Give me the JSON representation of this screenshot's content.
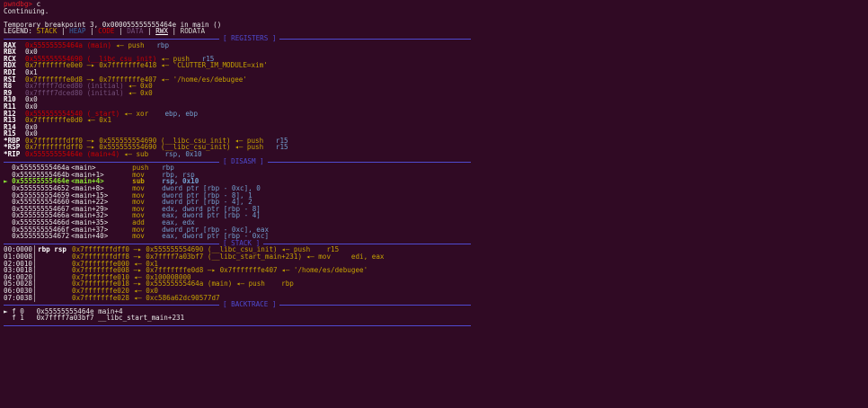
{
  "header": {
    "prompt": "pwndbg>",
    "command": " c",
    "continuing": "Continuing.",
    "breakpoint": "Temporary breakpoint 3, 0x000055555555464e in main ()",
    "legend_label": "LEGEND: ",
    "legend": [
      "STACK",
      "HEAP",
      "CODE",
      "DATA",
      "RWX",
      "RODATA"
    ]
  },
  "sections": {
    "registers": "[ REGISTERS ]",
    "disasm": "[ DISASM ]",
    "stack": "[ STACK ]",
    "backtrace": "[ BACKTRACE ]"
  },
  "registers": [
    {
      "name": "RAX",
      "a": "0x55555555464a",
      "b": "(main)",
      "c": "◂— push",
      "d": "   rbp"
    },
    {
      "name": "RBX",
      "a": "0x0",
      "b": "",
      "c": "",
      "d": ""
    },
    {
      "name": "RCX",
      "a": "0x555555554690",
      "b": "(__libc_csu_init)",
      "c": "◂— push",
      "d": "   r15"
    },
    {
      "name": "RDX",
      "a": "0x7fffffffe0e0",
      "b": "—▸ 0x7fffffffe418",
      "c": "◂— 'CLUTTER_IM_MODULE=xim'",
      "d": ""
    },
    {
      "name": "RDI",
      "a": "0x1",
      "b": "",
      "c": "",
      "d": ""
    },
    {
      "name": "RSI",
      "a": "0x7fffffffe0d8",
      "b": "—▸ 0x7fffffffe407",
      "c": "◂— '/home/es/debugee'",
      "d": ""
    },
    {
      "name": "R8",
      "a": "0x7ffff7dced80",
      "b": "(initial)",
      "c": "◂— 0x0",
      "d": ""
    },
    {
      "name": "R9",
      "a": "0x7ffff7dced80",
      "b": "(initial)",
      "c": "◂— 0x0",
      "d": ""
    },
    {
      "name": "R10",
      "a": "0x0",
      "b": "",
      "c": "",
      "d": ""
    },
    {
      "name": "R11",
      "a": "0x0",
      "b": "",
      "c": "",
      "d": ""
    },
    {
      "name": "R12",
      "a": "0x555555554540",
      "b": "(_start)",
      "c": "◂— xor",
      "d": "    ebp, ebp"
    },
    {
      "name": "R13",
      "a": "0x7fffffffe0d0",
      "b": "",
      "c": "◂— 0x1",
      "d": ""
    },
    {
      "name": "R14",
      "a": "0x0",
      "b": "",
      "c": "",
      "d": ""
    },
    {
      "name": "R15",
      "a": "0x0",
      "b": "",
      "c": "",
      "d": ""
    },
    {
      "name": "*RBP",
      "a": "0x7fffffffdff0",
      "b": "—▸ 0x555555554690 (__libc_csu_init)",
      "c": "◂— push",
      "d": "   r15"
    },
    {
      "name": "*RSP",
      "a": "0x7fffffffdff0",
      "b": "—▸ 0x555555554690 (__libc_csu_init)",
      "c": "◂— push",
      "d": "   r15"
    },
    {
      "name": "*RIP",
      "a": "0x55555555464e",
      "b": "(main+4)",
      "c": "◂— sub",
      "d": "    rsp, 0x10"
    }
  ],
  "disasm": [
    {
      "m": "",
      "addr": "0x55555555464a",
      "lbl": "<main>",
      "mn": "push",
      "opr": "rbp"
    },
    {
      "m": "",
      "addr": "0x55555555464b",
      "lbl": "<main+1>",
      "mn": "mov",
      "opr": "rbp, rsp"
    },
    {
      "m": "►",
      "addr": "0x55555555464e",
      "lbl": "<main+4>",
      "mn": "sub",
      "opr": "rsp, 0x10"
    },
    {
      "m": "",
      "addr": "0x555555554652",
      "lbl": "<main+8>",
      "mn": "mov",
      "opr": "dword ptr [rbp - 0xc], 0"
    },
    {
      "m": "",
      "addr": "0x555555554659",
      "lbl": "<main+15>",
      "mn": "mov",
      "opr": "dword ptr [rbp - 8], 1"
    },
    {
      "m": "",
      "addr": "0x555555554660",
      "lbl": "<main+22>",
      "mn": "mov",
      "opr": "dword ptr [rbp - 4], 2"
    },
    {
      "m": "",
      "addr": "0x555555554667",
      "lbl": "<main+29>",
      "mn": "mov",
      "opr": "edx, dword ptr [rbp - 8]"
    },
    {
      "m": "",
      "addr": "0x55555555466a",
      "lbl": "<main+32>",
      "mn": "mov",
      "opr": "eax, dword ptr [rbp - 4]"
    },
    {
      "m": "",
      "addr": "0x55555555466d",
      "lbl": "<main+35>",
      "mn": "add",
      "opr": "eax, edx"
    },
    {
      "m": "",
      "addr": "0x55555555466f",
      "lbl": "<main+37>",
      "mn": "mov",
      "opr": "dword ptr [rbp - 0xc], eax"
    },
    {
      "m": "",
      "addr": "0x555555554672",
      "lbl": "<main+40>",
      "mn": "mov",
      "opr": "eax, dword ptr [rbp - 0xc]"
    }
  ],
  "stack": [
    {
      "off": "00:0000│",
      "rg": "rbp rsp",
      "rest": "0x7fffffffdff0 —▸ 0x555555554690 (__libc_csu_init) ◂— push    r15"
    },
    {
      "off": "01:0008│",
      "rg": "",
      "rest": "0x7fffffffdff8 —▸ 0x7ffff7a03bf7 (__libc_start_main+231) ◂— mov     edi, eax"
    },
    {
      "off": "02:0010│",
      "rg": "",
      "rest": "0x7fffffffe000 ◂— 0x1"
    },
    {
      "off": "03:0018│",
      "rg": "",
      "rest": "0x7fffffffe008 —▸ 0x7fffffffe0d8 —▸ 0x7fffffffe407 ◂— '/home/es/debugee'"
    },
    {
      "off": "04:0020│",
      "rg": "",
      "rest": "0x7fffffffe010 ◂— 0x100008000"
    },
    {
      "off": "05:0028│",
      "rg": "",
      "rest": "0x7fffffffe018 —▸ 0x55555555464a (main) ◂— push    rbp"
    },
    {
      "off": "06:0030│",
      "rg": "",
      "rest": "0x7fffffffe020 ◂— 0x0"
    },
    {
      "off": "07:0038│",
      "rg": "",
      "rest": "0x7fffffffe028 ◂— 0xc586a62dc90577d7"
    }
  ],
  "backtrace": [
    {
      "m": "► f 0",
      "addr": "0x55555555464e",
      "fn": "main+4"
    },
    {
      "m": "  f 1",
      "addr": "0x7ffff7a03bf7",
      "fn": "__libc_start_main+231"
    }
  ]
}
